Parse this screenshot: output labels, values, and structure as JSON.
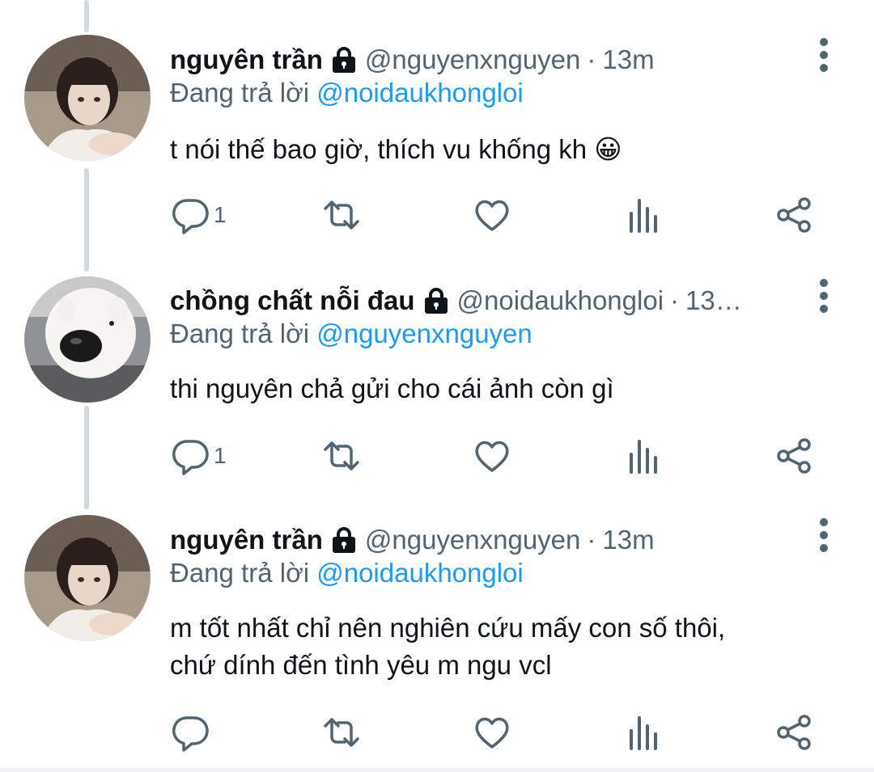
{
  "colors": {
    "text": "#0f1419",
    "muted": "#536471",
    "accent": "#1d9bf0",
    "thread": "#cfd9de"
  },
  "reply_prefix": "Đang trả lời",
  "tweets": [
    {
      "display_name": "nguyên trần",
      "handle": "@nguyenxnguyen",
      "separator": "·",
      "time": "13m",
      "reply_to": "@noidaukhongloi",
      "text_lines": [
        "t nói thế bao giờ, thích vu khống kh 😀"
      ],
      "reply_count": "1",
      "avatar": "girl-photo"
    },
    {
      "display_name": "chồng chất nỗi đau",
      "handle": "@noidaukhongloi",
      "separator": "·",
      "time": "13…",
      "reply_to": "@nguyenxnguyen",
      "text_lines": [
        "thi nguyên chả gửi cho cái ảnh còn gì"
      ],
      "reply_count": "1",
      "avatar": "dog-photo"
    },
    {
      "display_name": "nguyên trần",
      "handle": "@nguyenxnguyen",
      "separator": "·",
      "time": "13m",
      "reply_to": "@noidaukhongloi",
      "text_lines": [
        "m tốt nhất chỉ nên nghiên cứu mấy con số thôi,",
        "chứ dính đến tình yêu m ngu vcl"
      ],
      "reply_count": "",
      "avatar": "girl-photo"
    }
  ],
  "icons": [
    "lock-icon",
    "more-icon",
    "reply-icon",
    "retweet-icon",
    "like-icon",
    "views-icon",
    "share-icon"
  ]
}
